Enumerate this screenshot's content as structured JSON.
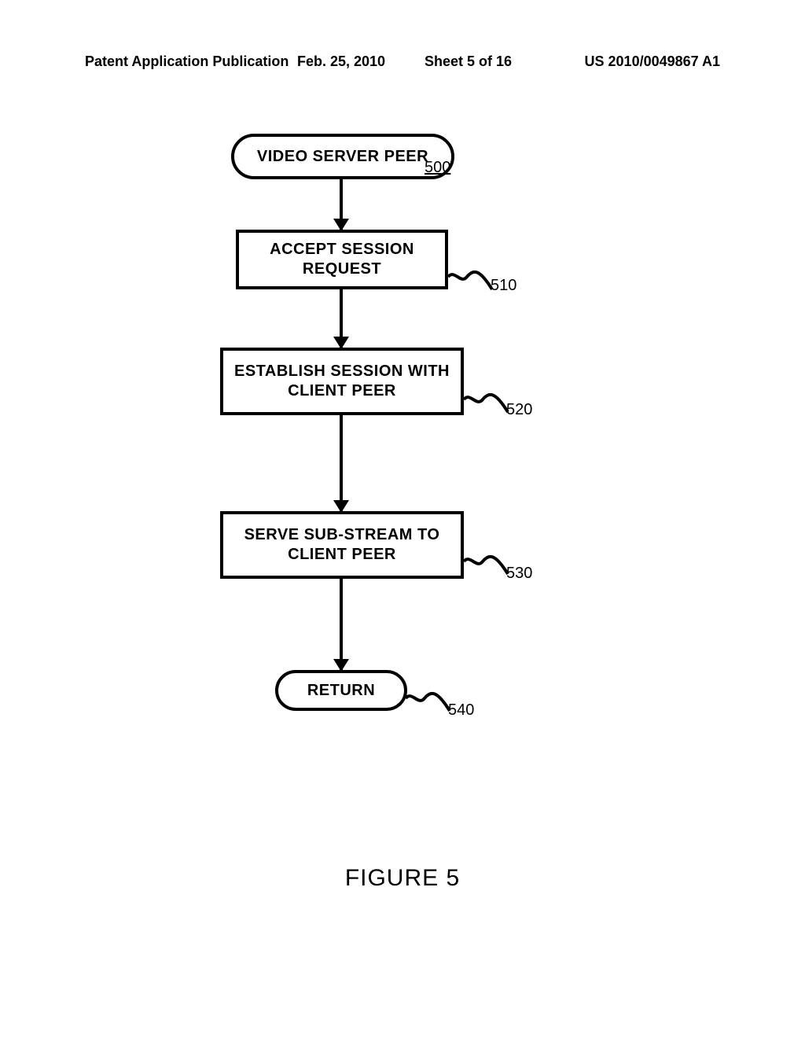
{
  "header": {
    "left": "Patent Application Publication",
    "center": "Feb. 25, 2010",
    "sheet": "Sheet 5 of 16",
    "right": "US 2010/0049867 A1"
  },
  "flowchart": {
    "start": {
      "label": "VIDEO SERVER PEER",
      "ref": "500"
    },
    "steps": [
      {
        "label": "ACCEPT SESSION REQUEST",
        "ref": "510"
      },
      {
        "label": "ESTABLISH SESSION WITH CLIENT PEER",
        "ref": "520"
      },
      {
        "label": "SERVE SUB-STREAM TO CLIENT PEER",
        "ref": "530"
      }
    ],
    "end": {
      "label": "RETURN",
      "ref": "540"
    }
  },
  "figure_caption": "FIGURE 5"
}
